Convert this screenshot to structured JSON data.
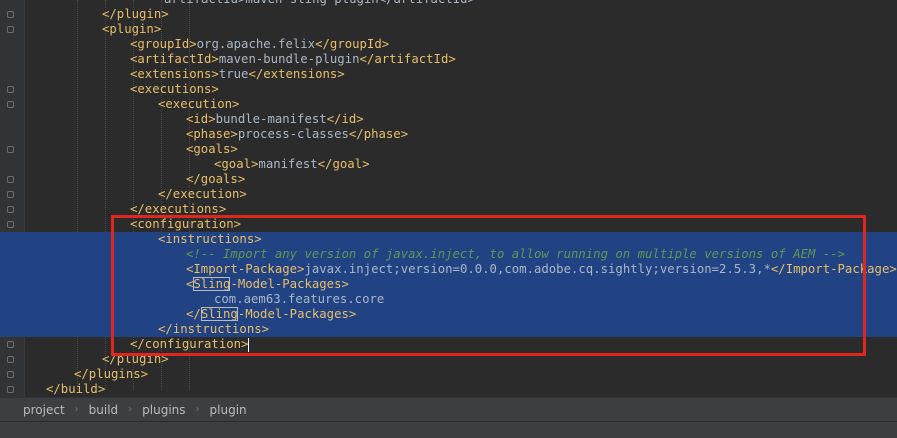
{
  "editor": {
    "lines": [
      [
        {
          "c": "v",
          "t": "artifactId>maven-sling-plugin</artifactId>"
        }
      ],
      [
        {
          "c": "t",
          "t": "</plugin>"
        }
      ],
      [
        {
          "c": "t",
          "t": "<plugin>"
        }
      ],
      [
        {
          "c": "t",
          "t": "<groupId>"
        },
        {
          "c": "v",
          "t": "org.apache.felix"
        },
        {
          "c": "t",
          "t": "</groupId>"
        }
      ],
      [
        {
          "c": "t",
          "t": "<artifactId>"
        },
        {
          "c": "v",
          "t": "maven-bundle-plugin"
        },
        {
          "c": "t",
          "t": "</artifactId>"
        }
      ],
      [
        {
          "c": "t",
          "t": "<extensions>"
        },
        {
          "c": "v",
          "t": "true"
        },
        {
          "c": "t",
          "t": "</extensions>"
        }
      ],
      [
        {
          "c": "t",
          "t": "<executions>"
        }
      ],
      [
        {
          "c": "t",
          "t": "<execution>"
        }
      ],
      [
        {
          "c": "t",
          "t": "<id>"
        },
        {
          "c": "v",
          "t": "bundle-manifest"
        },
        {
          "c": "t",
          "t": "</id>"
        }
      ],
      [
        {
          "c": "t",
          "t": "<phase>"
        },
        {
          "c": "v",
          "t": "process-classes"
        },
        {
          "c": "t",
          "t": "</phase>"
        }
      ],
      [
        {
          "c": "t",
          "t": "<goals>"
        }
      ],
      [
        {
          "c": "t",
          "t": "<goal>"
        },
        {
          "c": "v",
          "t": "manifest"
        },
        {
          "c": "t",
          "t": "</goal>"
        }
      ],
      [
        {
          "c": "t",
          "t": "</goals>"
        }
      ],
      [
        {
          "c": "t",
          "t": "</execution>"
        }
      ],
      [
        {
          "c": "t",
          "t": "</executions>"
        }
      ],
      [
        {
          "c": "t",
          "t": "<configuration>"
        }
      ],
      [
        {
          "c": "t",
          "t": "<instructions>"
        }
      ],
      [
        {
          "c": "c",
          "t": "<!-- Import any version of javax.inject, to allow running on multiple versions of AEM -->"
        }
      ],
      [
        {
          "c": "t",
          "t": "<Import-Package>"
        },
        {
          "c": "v",
          "t": "javax.inject;version=0.0.0,com.adobe.cq.sightly;version=2.5.3,*"
        },
        {
          "c": "t",
          "t": "</Import-Package>"
        }
      ],
      [
        {
          "c": "t",
          "t": "<"
        },
        {
          "c": "t",
          "b": 1,
          "t": "Sling"
        },
        {
          "c": "t",
          "t": "-Model-Packages>"
        }
      ],
      [
        {
          "c": "v",
          "t": "com.aem63.features.core"
        }
      ],
      [
        {
          "c": "t",
          "t": "</"
        },
        {
          "c": "t",
          "b": 1,
          "t": "Sling"
        },
        {
          "c": "t",
          "t": "-Model-Packages>"
        }
      ],
      [
        {
          "c": "t",
          "t": "</instructions>"
        }
      ],
      [
        {
          "c": "t",
          "t": "</configuration>"
        }
      ],
      [
        {
          "c": "t",
          "t": "</plugin>"
        }
      ],
      [
        {
          "c": "t",
          "t": "</plugins>"
        }
      ],
      [
        {
          "c": "t",
          "t": "</build>"
        }
      ]
    ]
  },
  "breadcrumb": {
    "items": [
      "project",
      "build",
      "plugins",
      "plugin"
    ],
    "separator": "›"
  },
  "colors": {
    "background": "#2b2b2b",
    "tag": "#e8bf6a",
    "text": "#a9b7c6",
    "comment": "#629755",
    "selection": "#214283",
    "annotation_box": "#e0271f"
  }
}
